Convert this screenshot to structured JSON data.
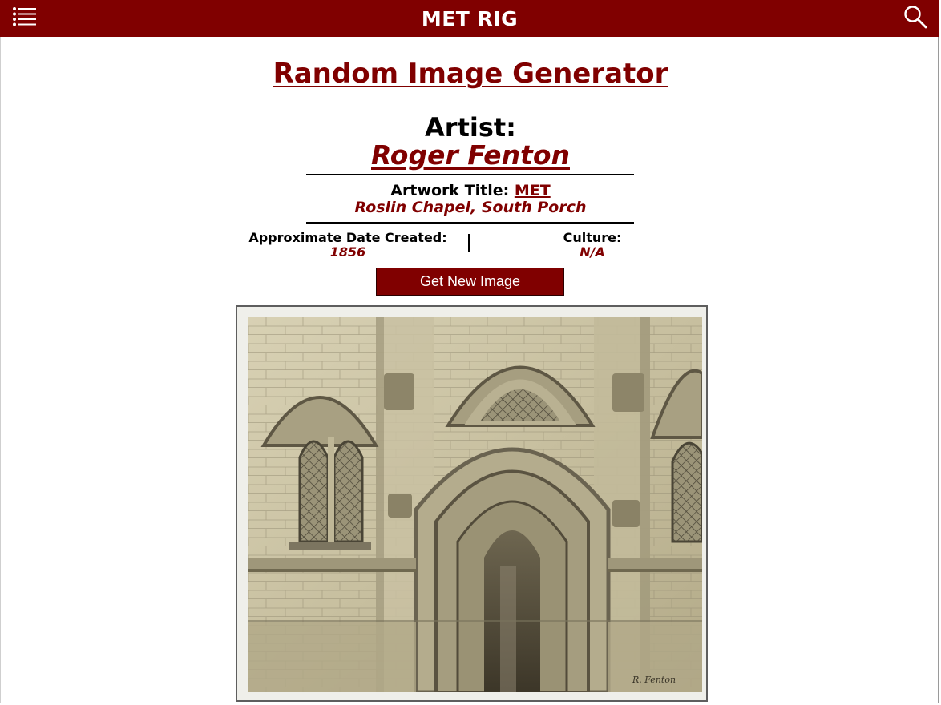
{
  "navbar": {
    "brand": "MET RIG",
    "menu_icon": "list-icon",
    "search_icon": "search-icon",
    "background": "#800000"
  },
  "page": {
    "title": "Random Image Generator"
  },
  "artist": {
    "label": "Artist:",
    "name": "Roger Fenton"
  },
  "artwork": {
    "label": "Artwork Title:",
    "source_link": "MET",
    "title": "Roslin Chapel, South Porch"
  },
  "meta": {
    "date_label": "Approximate Date Created:",
    "date_value": "1856",
    "culture_label": "Culture:",
    "culture_value": "N/A"
  },
  "actions": {
    "new_image_label": "Get New Image"
  },
  "image": {
    "alt": "Roslin Chapel, South Porch",
    "signature": "R. Fenton"
  },
  "colors": {
    "accent": "#800000",
    "text": "#000000",
    "button_text": "#ffffff"
  }
}
